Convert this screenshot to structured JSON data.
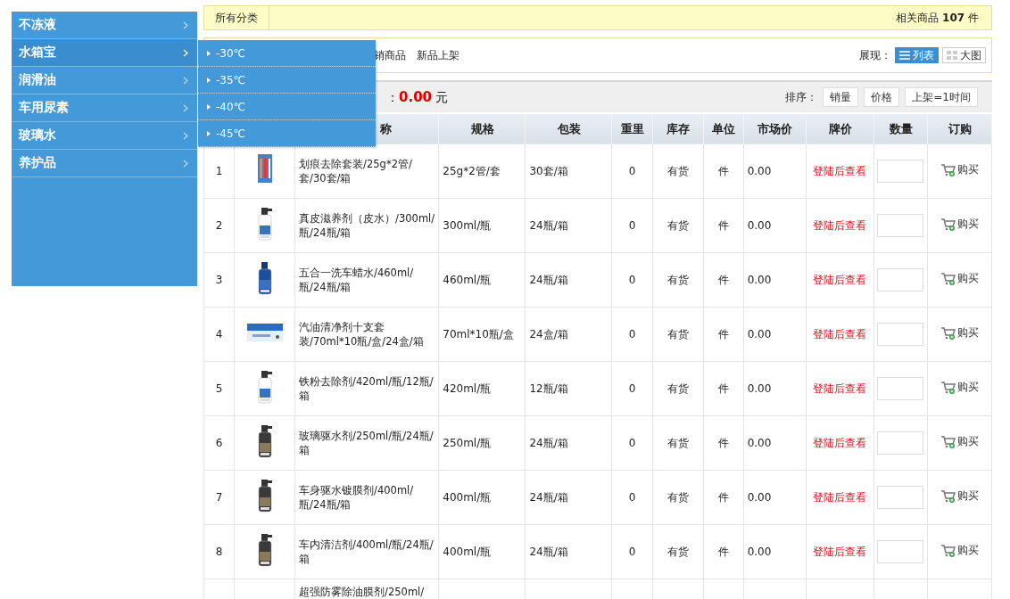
{
  "sidebar": {
    "items": [
      {
        "label": "不冻液",
        "selected": false
      },
      {
        "label": "水箱宝",
        "selected": true
      },
      {
        "label": "润滑油",
        "selected": false
      },
      {
        "label": "车用尿素",
        "selected": false
      },
      {
        "label": "玻璃水",
        "selected": false
      },
      {
        "label": "养护品",
        "selected": false
      }
    ],
    "submenu": [
      "-30℃",
      "-35℃",
      "-40℃",
      "-45℃"
    ]
  },
  "breadcrumb": {
    "label": "所有分类",
    "count_prefix": "相关商品",
    "count": "107",
    "count_suffix": "件"
  },
  "filter_bar": {
    "items": [
      "销商品",
      "新品上架"
    ],
    "view_label": "展现：",
    "views": [
      {
        "label": "列表",
        "kind": "list",
        "selected": true
      },
      {
        "label": "大图",
        "kind": "grid",
        "selected": false
      }
    ]
  },
  "cart_bar": {
    "label": "：",
    "amount": "0.00",
    "unit": "元",
    "sort_label": "排序：",
    "sort_buttons": [
      "销量",
      "价格",
      "上架=1时间"
    ]
  },
  "table": {
    "columns": [
      "称",
      "规格",
      "包装",
      "重里",
      "库存",
      "单位",
      "市场价",
      "牌价",
      "数量",
      "订购"
    ],
    "rows": [
      {
        "no": "1",
        "name": "划痕去除套装/25g*2管/套/30套/箱",
        "spec": "25g*2管/套",
        "pack": "30套/箱",
        "weight": "0",
        "stock": "有货",
        "unit": "件",
        "market": "0.00",
        "price": "登陆后查看",
        "buy": "购买",
        "kind": "kit"
      },
      {
        "no": "2",
        "name": "真皮滋养剂（皮水）/300ml/瓶/24瓶/箱",
        "spec": "300ml/瓶",
        "pack": "24瓶/箱",
        "weight": "0",
        "stock": "有货",
        "unit": "件",
        "market": "0.00",
        "price": "登陆后查看",
        "buy": "购买",
        "kind": "spray"
      },
      {
        "no": "3",
        "name": "五合一洗车蜡水/460ml/瓶/24瓶/箱",
        "spec": "460ml/瓶",
        "pack": "24瓶/箱",
        "weight": "0",
        "stock": "有货",
        "unit": "件",
        "market": "0.00",
        "price": "登陆后查看",
        "buy": "购买",
        "kind": "bottle"
      },
      {
        "no": "4",
        "name": "汽油清净剂十支套装/70ml*10瓶/盒/24盒/箱",
        "spec": "70ml*10瓶/盒",
        "pack": "24盒/箱",
        "weight": "0",
        "stock": "有货",
        "unit": "件",
        "market": "0.00",
        "price": "登陆后查看",
        "buy": "购买",
        "kind": "box"
      },
      {
        "no": "5",
        "name": "铁粉去除剂/420ml/瓶/12瓶/箱",
        "spec": "420ml/瓶",
        "pack": "12瓶/箱",
        "weight": "0",
        "stock": "有货",
        "unit": "件",
        "market": "0.00",
        "price": "登陆后查看",
        "buy": "购买",
        "kind": "spray"
      },
      {
        "no": "6",
        "name": "玻璃驱水剂/250ml/瓶/24瓶/箱",
        "spec": "250ml/瓶",
        "pack": "24瓶/箱",
        "weight": "0",
        "stock": "有货",
        "unit": "件",
        "market": "0.00",
        "price": "登陆后查看",
        "buy": "购买",
        "kind": "dark"
      },
      {
        "no": "7",
        "name": "车身驱水镀膜剂/400ml/瓶/24瓶/箱",
        "spec": "400ml/瓶",
        "pack": "24瓶/箱",
        "weight": "0",
        "stock": "有货",
        "unit": "件",
        "market": "0.00",
        "price": "登陆后查看",
        "buy": "购买",
        "kind": "dark"
      },
      {
        "no": "8",
        "name": "车内清洁剂/400ml/瓶/24瓶/箱",
        "spec": "400ml/瓶",
        "pack": "24瓶/箱",
        "weight": "0",
        "stock": "有货",
        "unit": "件",
        "market": "0.00",
        "price": "登陆后查看",
        "buy": "购买",
        "kind": "dark"
      },
      {
        "name": "超强防雾除油膜剂/250ml/",
        "kind": "partial"
      }
    ]
  }
}
